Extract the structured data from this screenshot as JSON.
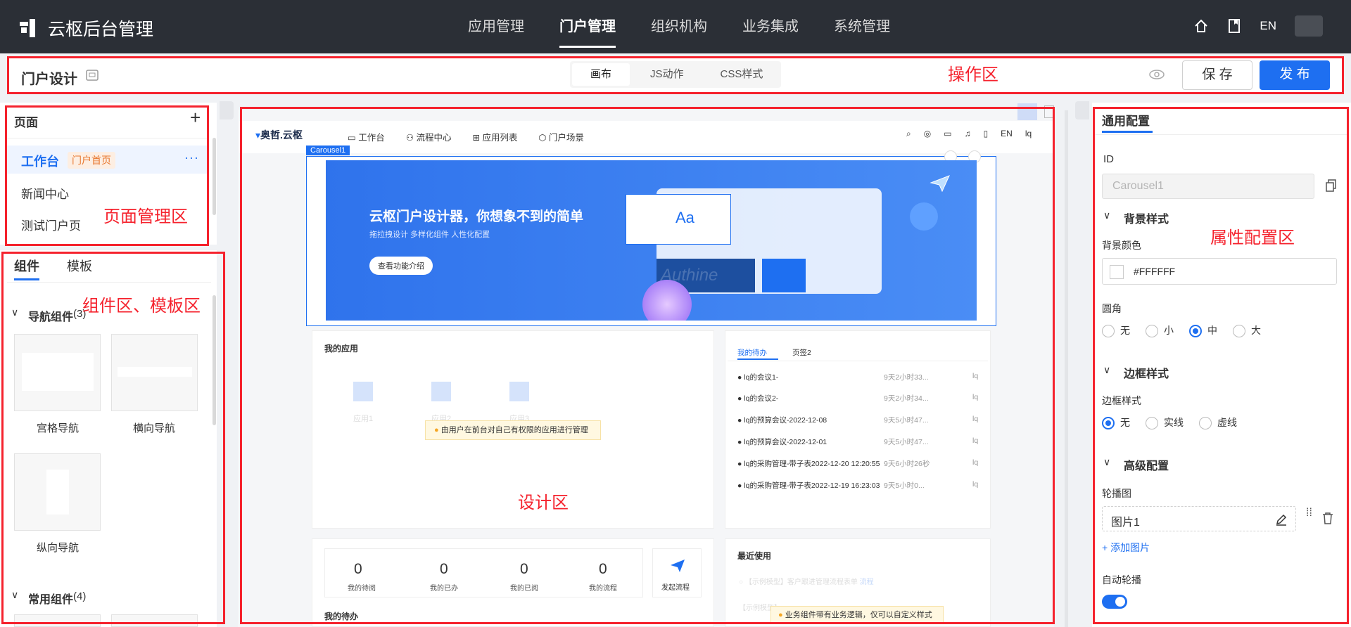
{
  "app": {
    "title": "云枢后台管理"
  },
  "top_nav": [
    "应用管理",
    "门户管理",
    "组织机构",
    "业务集成",
    "系统管理"
  ],
  "top_right": {
    "lang": "EN"
  },
  "toolbar": {
    "title": "门户设计",
    "tabs": [
      "画布",
      "JS动作",
      "CSS样式"
    ],
    "save": "保 存",
    "publish": "发 布",
    "zone_label": "操作区"
  },
  "pages": {
    "header": "页面",
    "items": [
      {
        "label": "工作台",
        "badge": "门户首页"
      },
      {
        "label": "新闻中心"
      },
      {
        "label": "测试门户页"
      }
    ],
    "zone_label": "页面管理区"
  },
  "components": {
    "tabs": [
      "组件",
      "模板"
    ],
    "zone_label": "组件区、模板区",
    "groups": [
      {
        "title": "导航组件",
        "count": "(3)",
        "items": [
          "宫格导航",
          "横向导航",
          "纵向导航"
        ]
      },
      {
        "title": "常用组件",
        "count": "(4)"
      }
    ]
  },
  "canvas": {
    "zone_label": "设计区",
    "brand": "奥哲.云枢",
    "nav": [
      "工作台",
      "流程中心",
      "应用列表",
      "门户场景"
    ],
    "lang": "EN",
    "user_short": "lq",
    "carousel_tag": "Carousel1",
    "banner_title": "云枢门户设计器，你想象不到的简单",
    "banner_sub": "拖拉拽设计    多样化组件    人性化配置",
    "banner_btn": "查看功能介绍",
    "banner_card_text": "Aa",
    "banner_watermark": "Authine",
    "my_apps": {
      "title": "我的应用",
      "apps": [
        "应用1",
        "应用2",
        "应用3"
      ],
      "hint": "由用户在前台对自己有权限的应用进行管理"
    },
    "todo": {
      "tabs": [
        "我的待办",
        "页签2"
      ],
      "rows": [
        {
          "title": "lq的会议1-",
          "time": "9天2小时33...",
          "user": "lq"
        },
        {
          "title": "lq的会议2-",
          "time": "9天2小时34...",
          "user": "lq"
        },
        {
          "title": "lq的预算会议-2022-12-08",
          "time": "9天5小时47...",
          "user": "lq"
        },
        {
          "title": "lq的预算会议-2022-12-01",
          "time": "9天5小时47...",
          "user": "lq"
        },
        {
          "title": "lq的采购管理-带子表2022-12-20 12:20:55",
          "time": "9天6小时26秒",
          "user": "lq"
        },
        {
          "title": "lq的采购管理-带子表2022-12-19 16:23:03",
          "time": "9天5小时0...",
          "user": "lq"
        }
      ]
    },
    "stats": [
      {
        "value": "0",
        "label": "我的待阅"
      },
      {
        "value": "0",
        "label": "我的已办"
      },
      {
        "value": "0",
        "label": "我的已阅"
      },
      {
        "value": "0",
        "label": "我的流程"
      }
    ],
    "start_flow": "发起流程",
    "my_todo_title": "我的待办",
    "recent": {
      "title": "最近使用",
      "items": [
        "【示例模型】客户跟进管理流程表单",
        "【示例模型】..."
      ],
      "item_tag": "流程",
      "hint": "业务组件带有业务逻辑，仅可以自定义样式"
    }
  },
  "props": {
    "tab": "通用配置",
    "zone_label": "属性配置区",
    "id_label": "ID",
    "id_value": "Carousel1",
    "bg_section": "背景样式",
    "bg_color_label": "背景颜色",
    "bg_color_value": "#FFFFFF",
    "radius_label": "圆角",
    "radius_options": [
      "无",
      "小",
      "中",
      "大"
    ],
    "radius_selected": "中",
    "border_section": "边框样式",
    "border_label": "边框样式",
    "border_options": [
      "无",
      "实线",
      "虚线"
    ],
    "border_selected": "无",
    "adv_section": "高级配置",
    "carousel_label": "轮播图",
    "carousel_item": "图片1",
    "add_image": "+ 添加图片",
    "autoplay_label": "自动轮播",
    "autoplay_on": true
  },
  "colors": {
    "primary": "#1e6ff1",
    "red": "#f5222d",
    "topbar": "#2b2f36",
    "banner": "#3d7ef1"
  }
}
